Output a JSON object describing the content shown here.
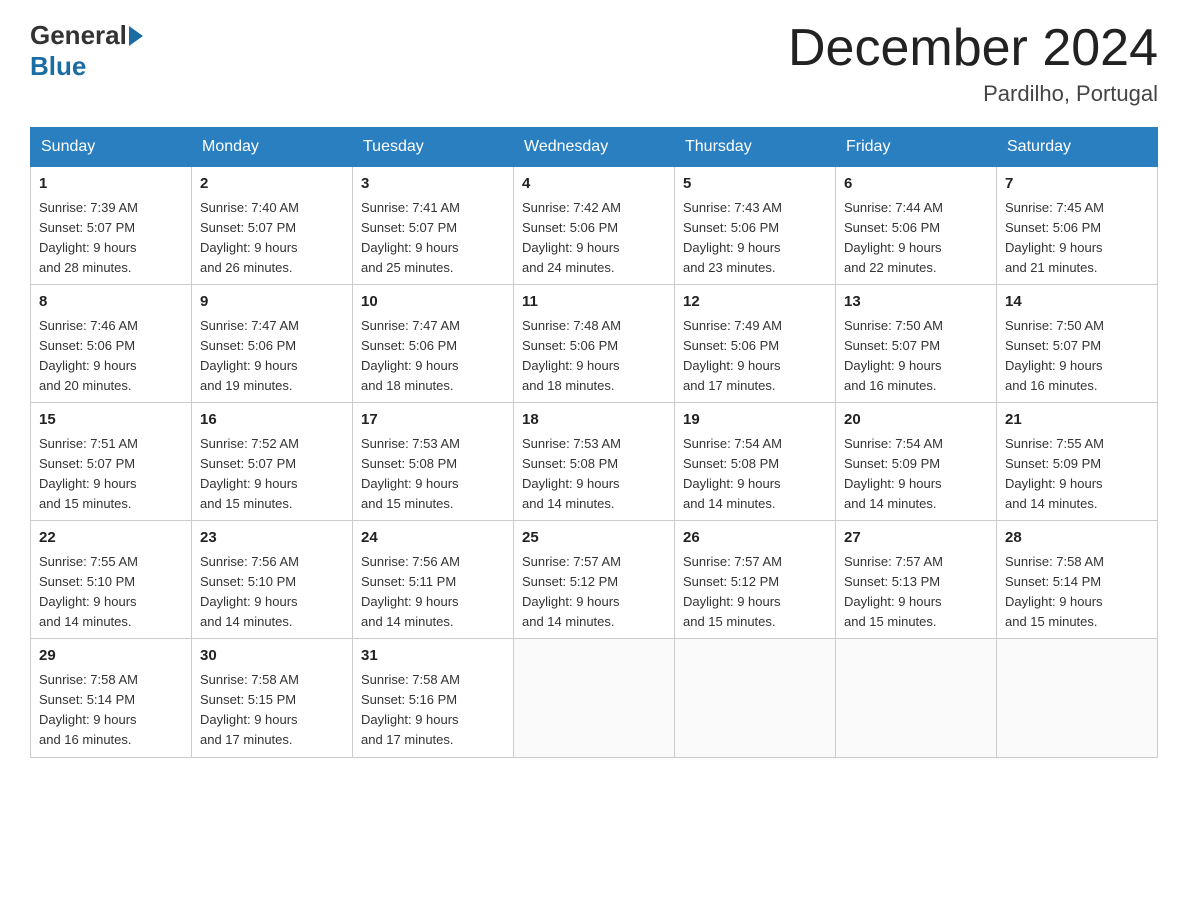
{
  "header": {
    "logo_general": "General",
    "logo_blue": "Blue",
    "month_title": "December 2024",
    "location": "Pardilho, Portugal"
  },
  "weekdays": [
    "Sunday",
    "Monday",
    "Tuesday",
    "Wednesday",
    "Thursday",
    "Friday",
    "Saturday"
  ],
  "weeks": [
    [
      {
        "day": "1",
        "sunrise": "7:39 AM",
        "sunset": "5:07 PM",
        "daylight": "9 hours and 28 minutes."
      },
      {
        "day": "2",
        "sunrise": "7:40 AM",
        "sunset": "5:07 PM",
        "daylight": "9 hours and 26 minutes."
      },
      {
        "day": "3",
        "sunrise": "7:41 AM",
        "sunset": "5:07 PM",
        "daylight": "9 hours and 25 minutes."
      },
      {
        "day": "4",
        "sunrise": "7:42 AM",
        "sunset": "5:06 PM",
        "daylight": "9 hours and 24 minutes."
      },
      {
        "day": "5",
        "sunrise": "7:43 AM",
        "sunset": "5:06 PM",
        "daylight": "9 hours and 23 minutes."
      },
      {
        "day": "6",
        "sunrise": "7:44 AM",
        "sunset": "5:06 PM",
        "daylight": "9 hours and 22 minutes."
      },
      {
        "day": "7",
        "sunrise": "7:45 AM",
        "sunset": "5:06 PM",
        "daylight": "9 hours and 21 minutes."
      }
    ],
    [
      {
        "day": "8",
        "sunrise": "7:46 AM",
        "sunset": "5:06 PM",
        "daylight": "9 hours and 20 minutes."
      },
      {
        "day": "9",
        "sunrise": "7:47 AM",
        "sunset": "5:06 PM",
        "daylight": "9 hours and 19 minutes."
      },
      {
        "day": "10",
        "sunrise": "7:47 AM",
        "sunset": "5:06 PM",
        "daylight": "9 hours and 18 minutes."
      },
      {
        "day": "11",
        "sunrise": "7:48 AM",
        "sunset": "5:06 PM",
        "daylight": "9 hours and 18 minutes."
      },
      {
        "day": "12",
        "sunrise": "7:49 AM",
        "sunset": "5:06 PM",
        "daylight": "9 hours and 17 minutes."
      },
      {
        "day": "13",
        "sunrise": "7:50 AM",
        "sunset": "5:07 PM",
        "daylight": "9 hours and 16 minutes."
      },
      {
        "day": "14",
        "sunrise": "7:50 AM",
        "sunset": "5:07 PM",
        "daylight": "9 hours and 16 minutes."
      }
    ],
    [
      {
        "day": "15",
        "sunrise": "7:51 AM",
        "sunset": "5:07 PM",
        "daylight": "9 hours and 15 minutes."
      },
      {
        "day": "16",
        "sunrise": "7:52 AM",
        "sunset": "5:07 PM",
        "daylight": "9 hours and 15 minutes."
      },
      {
        "day": "17",
        "sunrise": "7:53 AM",
        "sunset": "5:08 PM",
        "daylight": "9 hours and 15 minutes."
      },
      {
        "day": "18",
        "sunrise": "7:53 AM",
        "sunset": "5:08 PM",
        "daylight": "9 hours and 14 minutes."
      },
      {
        "day": "19",
        "sunrise": "7:54 AM",
        "sunset": "5:08 PM",
        "daylight": "9 hours and 14 minutes."
      },
      {
        "day": "20",
        "sunrise": "7:54 AM",
        "sunset": "5:09 PM",
        "daylight": "9 hours and 14 minutes."
      },
      {
        "day": "21",
        "sunrise": "7:55 AM",
        "sunset": "5:09 PM",
        "daylight": "9 hours and 14 minutes."
      }
    ],
    [
      {
        "day": "22",
        "sunrise": "7:55 AM",
        "sunset": "5:10 PM",
        "daylight": "9 hours and 14 minutes."
      },
      {
        "day": "23",
        "sunrise": "7:56 AM",
        "sunset": "5:10 PM",
        "daylight": "9 hours and 14 minutes."
      },
      {
        "day": "24",
        "sunrise": "7:56 AM",
        "sunset": "5:11 PM",
        "daylight": "9 hours and 14 minutes."
      },
      {
        "day": "25",
        "sunrise": "7:57 AM",
        "sunset": "5:12 PM",
        "daylight": "9 hours and 14 minutes."
      },
      {
        "day": "26",
        "sunrise": "7:57 AM",
        "sunset": "5:12 PM",
        "daylight": "9 hours and 15 minutes."
      },
      {
        "day": "27",
        "sunrise": "7:57 AM",
        "sunset": "5:13 PM",
        "daylight": "9 hours and 15 minutes."
      },
      {
        "day": "28",
        "sunrise": "7:58 AM",
        "sunset": "5:14 PM",
        "daylight": "9 hours and 15 minutes."
      }
    ],
    [
      {
        "day": "29",
        "sunrise": "7:58 AM",
        "sunset": "5:14 PM",
        "daylight": "9 hours and 16 minutes."
      },
      {
        "day": "30",
        "sunrise": "7:58 AM",
        "sunset": "5:15 PM",
        "daylight": "9 hours and 17 minutes."
      },
      {
        "day": "31",
        "sunrise": "7:58 AM",
        "sunset": "5:16 PM",
        "daylight": "9 hours and 17 minutes."
      },
      null,
      null,
      null,
      null
    ]
  ],
  "labels": {
    "sunrise": "Sunrise:",
    "sunset": "Sunset:",
    "daylight": "Daylight:"
  }
}
